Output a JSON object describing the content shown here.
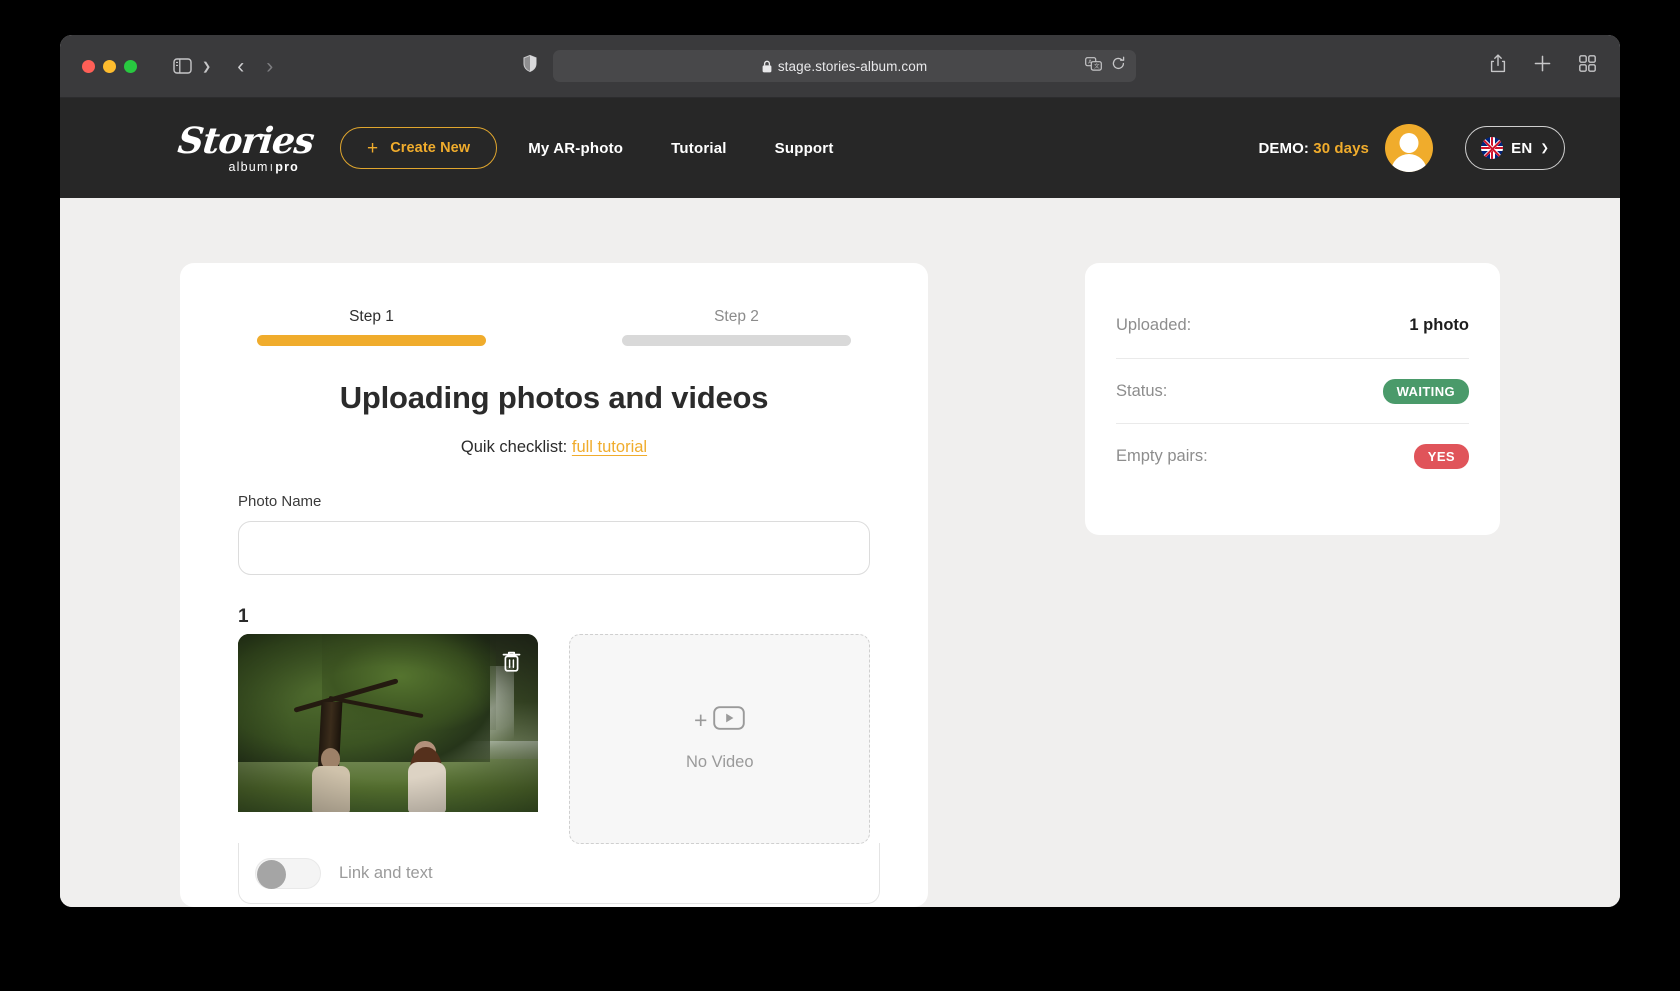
{
  "browser": {
    "url": "stage.stories-album.com",
    "lock_icon": "lock-icon",
    "shield_icon": "shield-icon",
    "translate_icon": "translate-icon",
    "reload_icon": "reload-icon",
    "share_icon": "share-icon",
    "new_tab_icon": "plus-icon",
    "tab_overview_icon": "tab-overview-icon",
    "sidebar_icon": "sidebar-icon",
    "back_icon": "chevron-left-icon",
    "forward_icon": "chevron-right-icon"
  },
  "header": {
    "logo_word": "Stories",
    "logo_sub_album": "album",
    "logo_sub_sep": "ı",
    "logo_sub_pro": "pro",
    "create_button": "Create New",
    "create_plus": "+",
    "nav": [
      {
        "label": "My AR-photo"
      },
      {
        "label": "Tutorial"
      },
      {
        "label": "Support"
      }
    ],
    "demo_prefix": "DEMO:",
    "demo_days": "30 days",
    "avatar_name": "user-avatar",
    "language": "EN",
    "language_flag": "uk-flag-icon",
    "language_chevron": "❯"
  },
  "steps": [
    {
      "label": "Step 1",
      "active": true
    },
    {
      "label": "Step 2",
      "active": false
    }
  ],
  "main": {
    "title": "Uploading photos and videos",
    "checklist_prefix": "Quik checklist:",
    "checklist_link": "full tutorial",
    "photo_name_label": "Photo Name",
    "photo_name_value": "",
    "photo_name_placeholder": "",
    "pair_index": "1",
    "delete_icon": "trash-icon",
    "video_plus": "+",
    "video_icon": "video-play-icon",
    "no_video_text": "No Video",
    "link_toggle_label": "Link and text",
    "link_toggle_state": "off"
  },
  "info": {
    "rows": [
      {
        "key": "Uploaded:",
        "value": "1 photo",
        "type": "text"
      },
      {
        "key": "Status:",
        "value": "WAITING",
        "type": "pill-green"
      },
      {
        "key": "Empty pairs:",
        "value": "YES",
        "type": "pill-red"
      }
    ]
  },
  "colors": {
    "accent": "#f0ac2c",
    "header_bg": "#272727",
    "page_bg": "#f0efee",
    "status_green": "#4a9a6a",
    "status_red": "#e0545a"
  }
}
